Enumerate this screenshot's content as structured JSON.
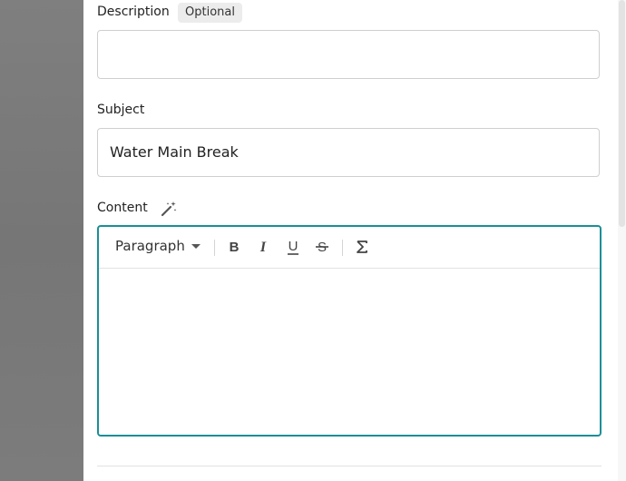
{
  "form": {
    "description": {
      "label": "Description",
      "badge": "Optional",
      "value": ""
    },
    "subject": {
      "label": "Subject",
      "value": "Water Main Break"
    },
    "content": {
      "label": "Content",
      "magic_icon": "magic-wand-icon",
      "toolbar": {
        "block_style": "Paragraph",
        "buttons": [
          "bold-icon",
          "italic-icon",
          "underline-icon",
          "strikethrough-icon",
          "sigma-icon"
        ]
      },
      "body": ""
    }
  },
  "colors": {
    "accent": "#1a8f96",
    "overlay": "#7a7a7a",
    "badge_bg": "#ececec"
  }
}
